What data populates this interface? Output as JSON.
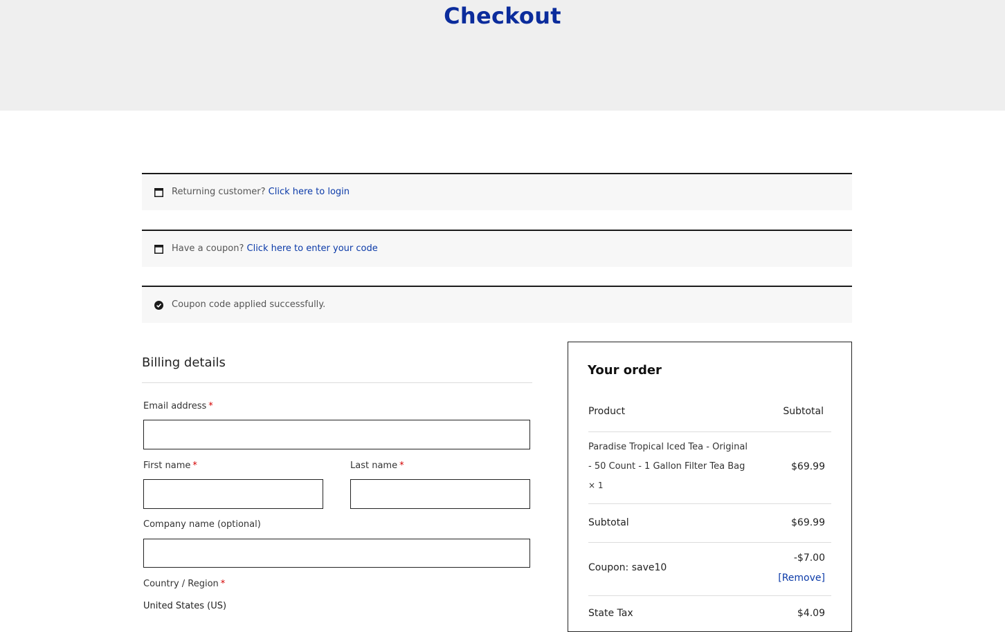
{
  "page": {
    "title": "Checkout"
  },
  "notices": {
    "returning": {
      "prefix": "Returning customer?",
      "link": "Click here to login"
    },
    "coupon": {
      "prefix": "Have a coupon?",
      "link": "Click here to enter your code"
    },
    "success": {
      "text": "Coupon code applied successfully."
    }
  },
  "billing": {
    "title": "Billing details",
    "required_mark": "*",
    "email_label": "Email address",
    "first_name_label": "First name",
    "last_name_label": "Last name",
    "company_label": "Company name (optional)",
    "country_label": "Country / Region",
    "country_value": "United States (US)",
    "email_value": "",
    "first_name_value": "",
    "last_name_value": "",
    "company_value": ""
  },
  "order": {
    "title": "Your order",
    "col_product": "Product",
    "col_subtotal": "Subtotal",
    "item": {
      "line1": "Paradise Tropical Iced Tea - Original",
      "line2": "- 50 Count - 1 Gallon Filter Tea Bag",
      "qty": "× 1",
      "price": "$69.99"
    },
    "subtotal_label": "Subtotal",
    "subtotal_value": "$69.99",
    "coupon_label": "Coupon: save10",
    "coupon_value": "-$7.00",
    "coupon_remove": "[Remove]",
    "tax_label": "State Tax",
    "tax_value": "$4.09"
  },
  "icons": {
    "notice_icon": "window-icon",
    "success_icon": "check-circle-icon"
  },
  "colors": {
    "brand": "#0b2c9c",
    "link": "#0b3aa8",
    "required": "#d40000"
  }
}
